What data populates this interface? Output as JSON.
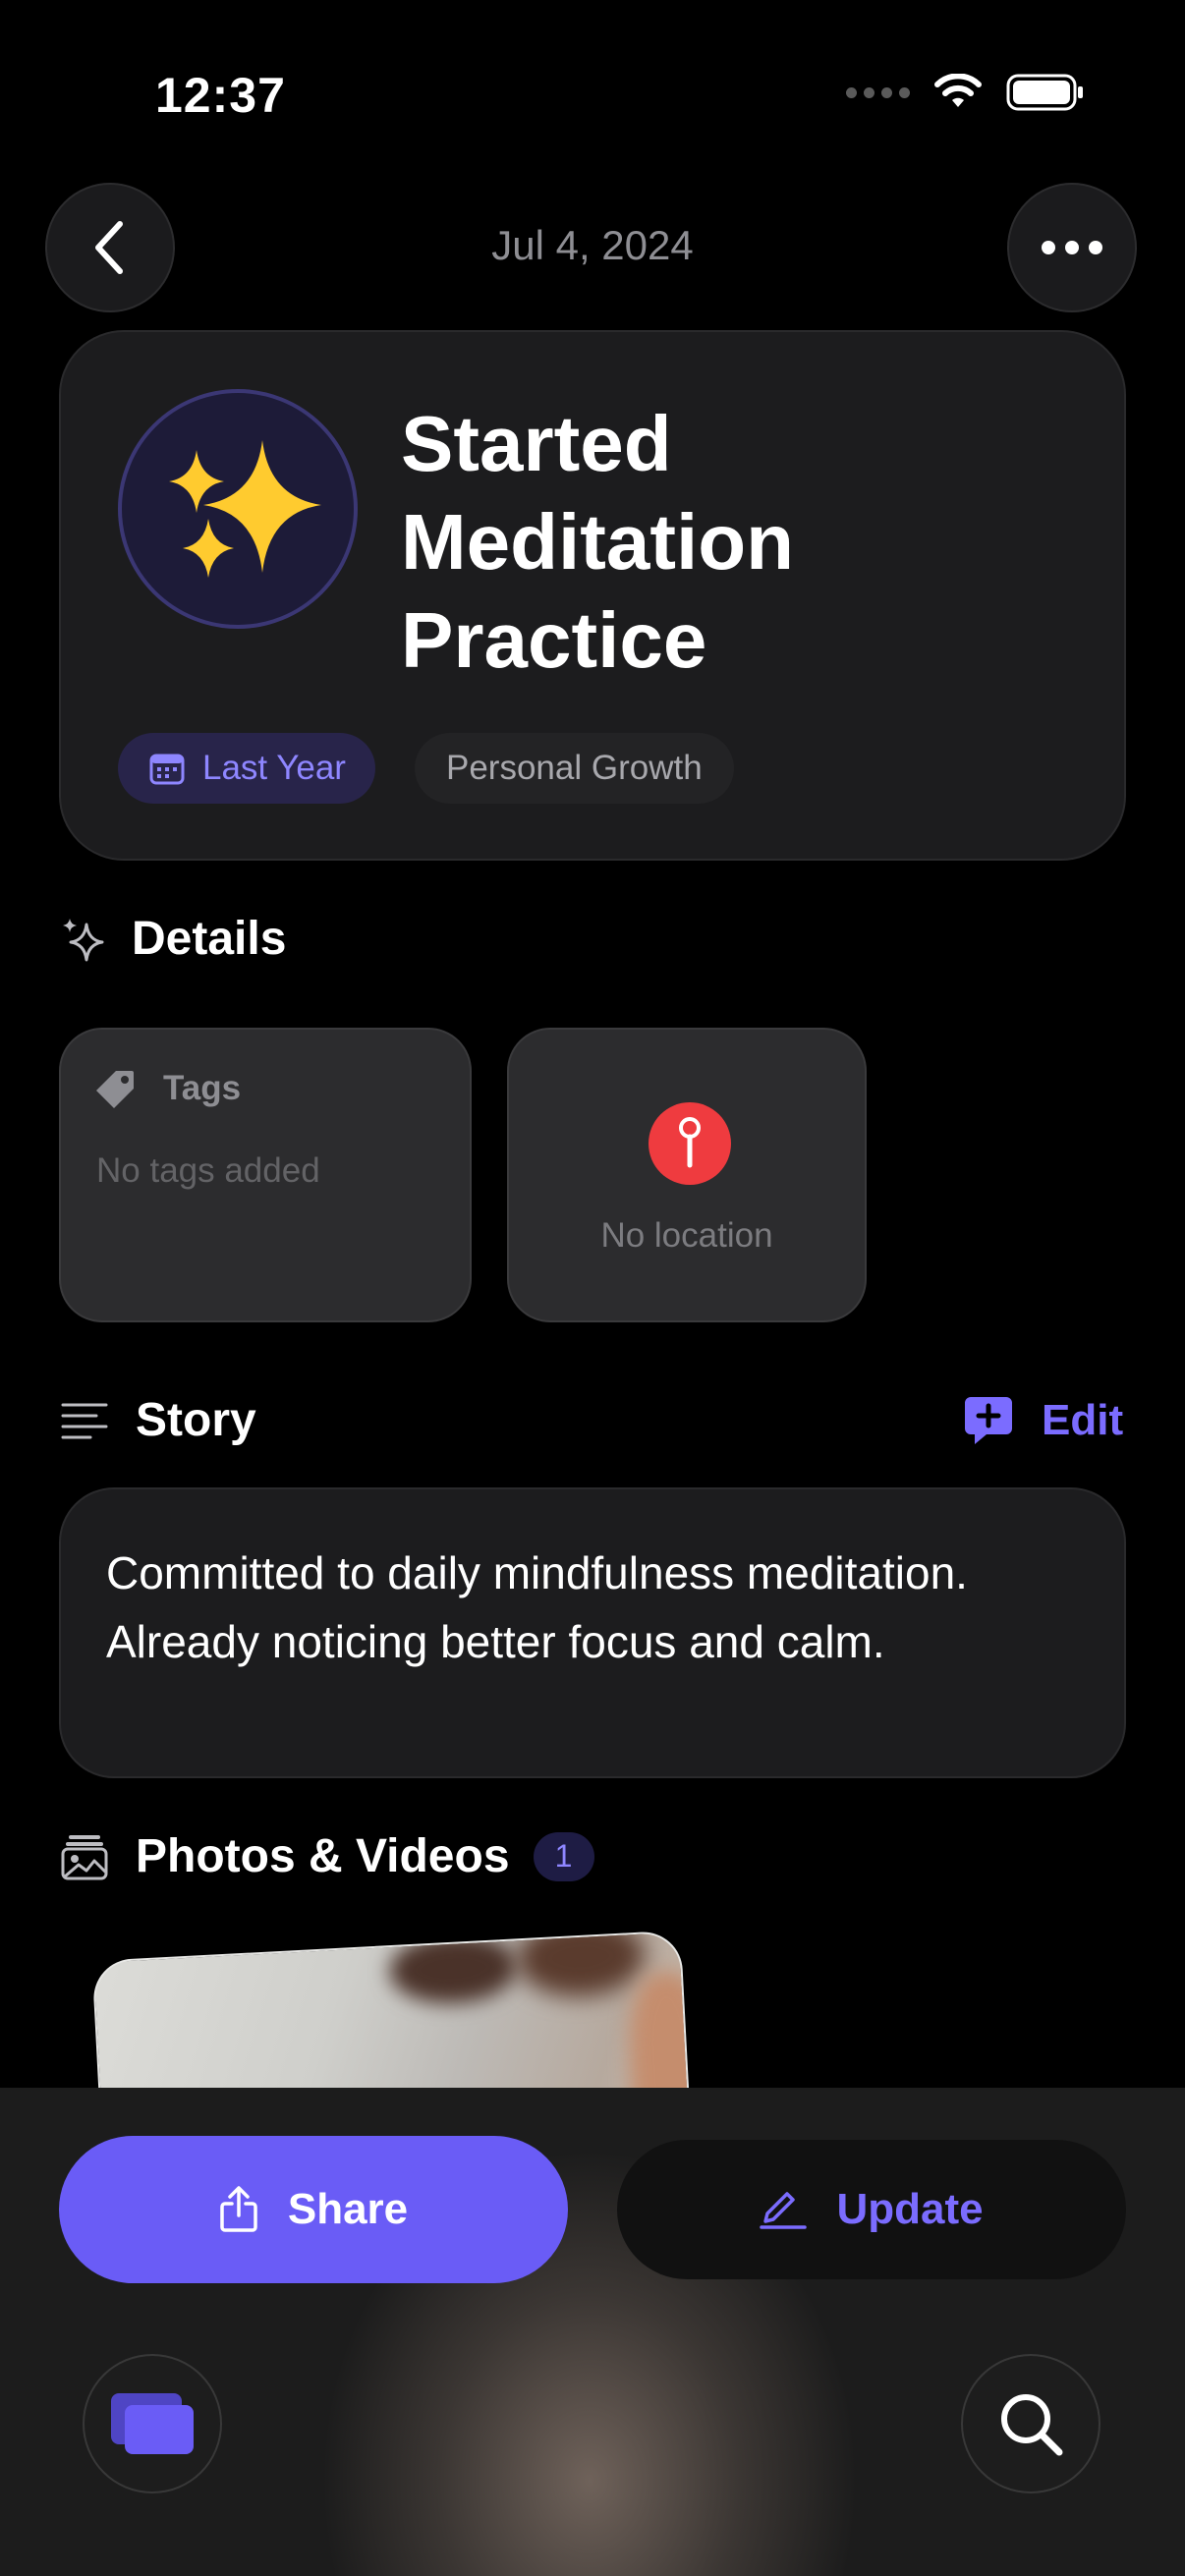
{
  "status_bar": {
    "time": "12:37"
  },
  "nav": {
    "date": "Jul 4, 2024"
  },
  "hero": {
    "title": "Started Meditation Practice",
    "chips": {
      "period": "Last Year",
      "category": "Personal Growth"
    }
  },
  "details": {
    "heading": "Details",
    "tags": {
      "label": "Tags",
      "empty": "No tags added"
    },
    "location": {
      "empty": "No location"
    }
  },
  "story": {
    "heading": "Story",
    "edit_label": "Edit",
    "text": "Committed to daily mindfulness meditation. Already noticing better focus and calm."
  },
  "photos": {
    "heading": "Photos & Videos",
    "count": "1"
  },
  "actions": {
    "share_label": "Share",
    "update_label": "Update"
  },
  "colors": {
    "accent": "#6a5cf6",
    "accent_text": "#7b6cff",
    "location_pin": "#ef3b3f",
    "background": "#000000",
    "card": "#1c1c1e"
  },
  "icons": [
    "back-chevron-icon",
    "more-icon",
    "sparkles-icon",
    "calendar-icon",
    "tag-icon",
    "location-pin-icon",
    "story-lines-icon",
    "add-comment-icon",
    "photos-icon",
    "share-icon",
    "pencil-icon",
    "gallery-icon",
    "search-icon"
  ]
}
